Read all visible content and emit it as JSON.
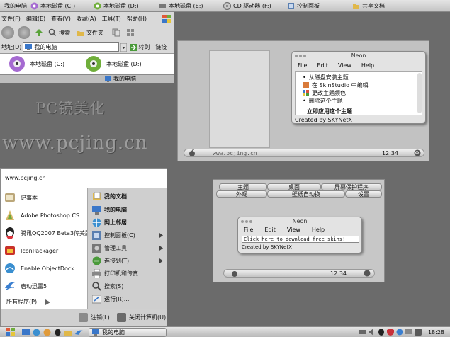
{
  "topbar": {
    "items": [
      {
        "label": "我的电脑",
        "icon": "computer-icon"
      },
      {
        "label": "本地磁盘 (C:)",
        "icon": "drive-c-icon"
      },
      {
        "label": "本地磁盘 (D:)",
        "icon": "drive-d-icon"
      },
      {
        "label": "本地磁盘 (E:)",
        "icon": "drive-e-icon"
      },
      {
        "label": "CD 驱动器 (F:)",
        "icon": "cd-drive-icon"
      },
      {
        "label": "控制面板",
        "icon": "control-panel-icon"
      },
      {
        "label": "共享文档",
        "icon": "folder-icon"
      }
    ]
  },
  "explorer": {
    "menu": [
      "文件(F)",
      "编辑(E)",
      "查看(V)",
      "收藏(A)",
      "工具(T)",
      "帮助(H)"
    ],
    "toolbar": {
      "search": "搜索",
      "folders": "文件夹"
    },
    "address_label": "地址(D)",
    "address_value": "我的电脑",
    "go_label": "转到",
    "links_label": "链接",
    "drives": [
      {
        "label": "本地磁盘 (C:)"
      },
      {
        "label": "本地磁盘 (D:)"
      }
    ],
    "status": "我的电脑"
  },
  "logo": {
    "title": "PC镜美化",
    "url": "www.pcjing.cn"
  },
  "preview_top": {
    "window_title": "Neon",
    "menu": [
      "File",
      "Edit",
      "View",
      "Help"
    ],
    "tasks": [
      "从磁盘安装主题",
      "在 SkinStudio 中编辑",
      "更改主题颜色",
      "删除这个主题",
      "立即应用这个主题"
    ],
    "created_by": "Created by SKYNetX",
    "bar_url": "www.pcjing.cn",
    "bar_time": "12:34"
  },
  "startmenu": {
    "header": "www.pcjing.cn",
    "left_items": [
      {
        "label": "记事本",
        "icon": "notepad-icon"
      },
      {
        "label": "Adobe Photoshop CS",
        "icon": "photoshop-icon"
      },
      {
        "label": "腾讯QQ2007 Beta3传美版",
        "icon": "qq-icon"
      },
      {
        "label": "IconPackager",
        "icon": "iconpackager-icon"
      },
      {
        "label": "Enable ObjectDock",
        "icon": "objectdock-icon"
      },
      {
        "label": "启动迅雷5",
        "icon": "thunder-icon"
      }
    ],
    "all_programs": "所有程序(P)",
    "right_items": [
      {
        "label": "我的文档",
        "bold": true
      },
      {
        "label": "我的电脑",
        "bold": true
      },
      {
        "label": "网上邻居",
        "bold": true
      },
      {
        "label": "控制面板(C)",
        "bold": false,
        "arrow": true
      },
      {
        "label": "管理工具",
        "bold": false,
        "arrow": true
      },
      {
        "label": "连接到(T)",
        "bold": false,
        "arrow": true
      },
      {
        "label": "打印机和传真",
        "bold": false
      },
      {
        "label": "搜索(S)",
        "bold": false
      },
      {
        "label": "运行(R)...",
        "bold": false
      }
    ],
    "logoff": "注销(L)",
    "shutdown": "关闭计算机(U)"
  },
  "panel": {
    "tabs_row1": [
      "主题",
      "桌面",
      "屏幕保护程序"
    ],
    "tabs_row2": [
      "外观",
      "壁纸自动换",
      "设置"
    ],
    "window_title": "Neon",
    "menu": [
      "File",
      "Edit",
      "View",
      "Help"
    ],
    "input_text": "Click here to download free skins!",
    "created_by": "Created by SKYNetX",
    "bar_time": "12:34"
  },
  "taskbar": {
    "active_window": "我的电脑",
    "time": "18:28"
  },
  "colors": {
    "accent": "#8a8a8a",
    "background": "#6b6b6b"
  }
}
